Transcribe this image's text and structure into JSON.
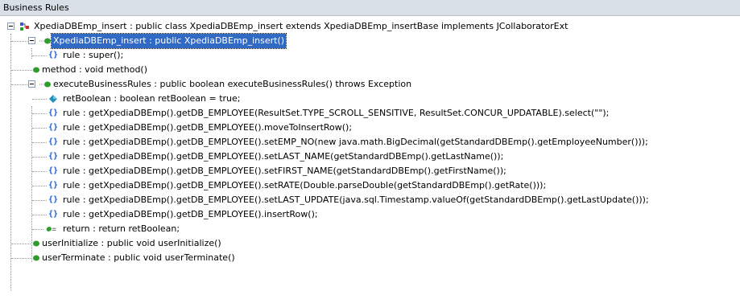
{
  "header": {
    "title": "Business Rules"
  },
  "tree": {
    "root": {
      "label": "XpediaDBEmp_insert : public class XpediaDBEmp_insert extends XpediaDBEmp_insertBase implements JCollaboratorExt",
      "icon": "class-icon"
    },
    "nodes": [
      {
        "label": "XpediaDBEmp_insert : public  XpediaDBEmp_insert()",
        "icon": "method-icon",
        "selected": true
      },
      {
        "label": "rule : super();",
        "icon": "rule-icon"
      },
      {
        "label": "method : void method()",
        "icon": "method-icon"
      },
      {
        "label": "executeBusinessRules : public boolean executeBusinessRules() throws Exception",
        "icon": "method-icon"
      },
      {
        "label": "retBoolean : boolean retBoolean = true;",
        "icon": "variable-icon"
      },
      {
        "label": "rule : getXpediaDBEmp().getDB_EMPLOYEE(ResultSet.TYPE_SCROLL_SENSITIVE, ResultSet.CONCUR_UPDATABLE).select(\"\");",
        "icon": "rule-icon"
      },
      {
        "label": "rule : getXpediaDBEmp().getDB_EMPLOYEE().moveToInsertRow();",
        "icon": "rule-icon"
      },
      {
        "label": "rule : getXpediaDBEmp().getDB_EMPLOYEE().setEMP_NO(new java.math.BigDecimal(getStandardDBEmp().getEmployeeNumber()));",
        "icon": "rule-icon"
      },
      {
        "label": "rule : getXpediaDBEmp().getDB_EMPLOYEE().setLAST_NAME(getStandardDBEmp().getLastName());",
        "icon": "rule-icon"
      },
      {
        "label": "rule : getXpediaDBEmp().getDB_EMPLOYEE().setFIRST_NAME(getStandardDBEmp().getFirstName());",
        "icon": "rule-icon"
      },
      {
        "label": "rule : getXpediaDBEmp().getDB_EMPLOYEE().setRATE(Double.parseDouble(getStandardDBEmp().getRate()));",
        "icon": "rule-icon"
      },
      {
        "label": "rule : getXpediaDBEmp().getDB_EMPLOYEE().setLAST_UPDATE(java.sql.Timestamp.valueOf(getStandardDBEmp().getLastUpdate()));",
        "icon": "rule-icon"
      },
      {
        "label": "rule : getXpediaDBEmp().getDB_EMPLOYEE().insertRow();",
        "icon": "rule-icon"
      },
      {
        "label": "return : return retBoolean;",
        "icon": "return-icon"
      },
      {
        "label": "userInitialize : public void userInitialize()",
        "icon": "method-icon"
      },
      {
        "label": "userTerminate : public void userTerminate()",
        "icon": "method-icon"
      }
    ]
  },
  "colors": {
    "method": "#2e9e2e",
    "rule": "#1b5fd1",
    "variable": "#1f8fb8",
    "selection": "#316ac5",
    "header": "#d9dfe7"
  }
}
